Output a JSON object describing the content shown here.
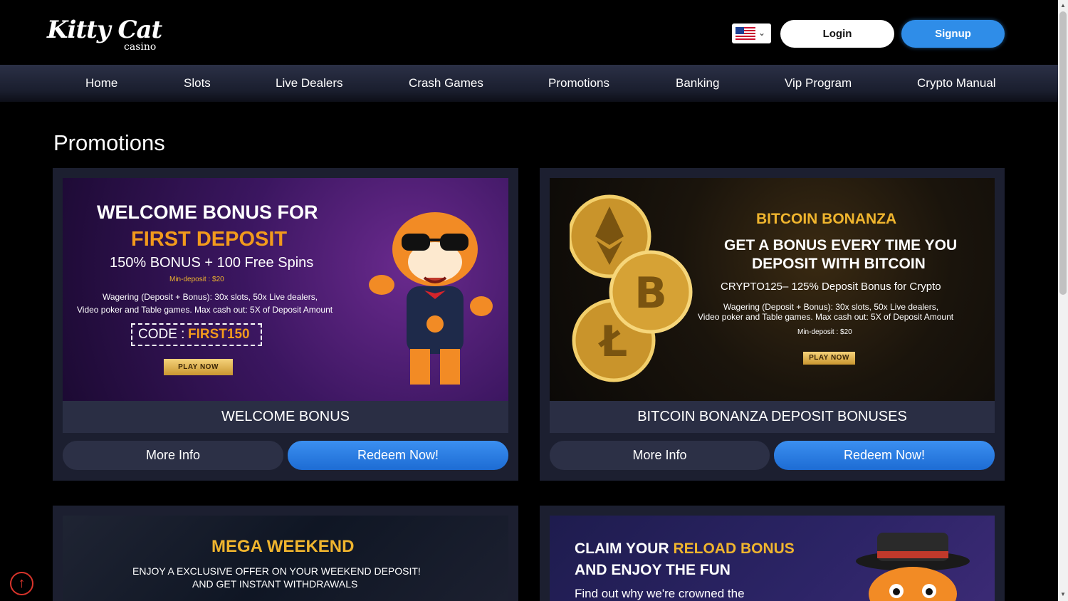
{
  "header": {
    "logo_text": "Kitty Cat",
    "logo_sub": "casino",
    "login_label": "Login",
    "signup_label": "Signup",
    "language_icon": "us-flag-icon"
  },
  "nav": {
    "items": [
      "Home",
      "Slots",
      "Live Dealers",
      "Crash Games",
      "Promotions",
      "Banking",
      "Vip Program",
      "Crypto Manual"
    ]
  },
  "page": {
    "title": "Promotions"
  },
  "promos": [
    {
      "title": "WELCOME BONUS",
      "more_label": "More Info",
      "redeem_label": "Redeem Now!",
      "banner": {
        "line1": "WELCOME BONUS FOR",
        "line2": "FIRST DEPOSIT",
        "line3": "150% BONUS + 100 Free Spins",
        "min_deposit": "Min-deposit : $20",
        "terms1": "Wagering (Deposit + Bonus): 30x slots, 50x Live dealers,",
        "terms2": "Video poker and Table games. Max cash out: 5X of Deposit Amount",
        "code_label": "CODE :",
        "code_value": "FIRST150",
        "play_now": "PLAY NOW"
      }
    },
    {
      "title": "BITCOIN BONANZA DEPOSIT BONUSES",
      "more_label": "More Info",
      "redeem_label": "Redeem Now!",
      "banner": {
        "line1": "BITCOIN  BONANZA",
        "line2": "GET A BONUS EVERY TIME YOU",
        "line3": "DEPOSIT WITH BITCOIN",
        "offer": "CRYPTO125– 125% Deposit Bonus for Crypto",
        "terms1": "Wagering (Deposit + Bonus): 30x slots, 50x Live dealers,",
        "terms2": "Video poker and Table games. Max cash out: 5X of Deposit Amount",
        "min_deposit": "Min-deposit : $20",
        "play_now": "PLAY NOW"
      }
    },
    {
      "banner": {
        "line1": "MEGA WEEKEND",
        "line2": "ENJOY A EXCLUSIVE OFFER ON YOUR WEEKEND DEPOSIT!",
        "line3": "AND GET INSTANT WITHDRAWALS"
      }
    },
    {
      "banner": {
        "line1a": "CLAIM YOUR ",
        "line1b": "RELOAD BONUS",
        "line2": "AND ENJOY THE FUN",
        "line3": "Find out why we're crowned the"
      }
    }
  ],
  "colors": {
    "accent_blue": "#2f8de8",
    "gold": "#f0b52e",
    "orange": "#f29a1c",
    "card_bg": "#1c1f30",
    "back_to_top": "#d9342b"
  }
}
